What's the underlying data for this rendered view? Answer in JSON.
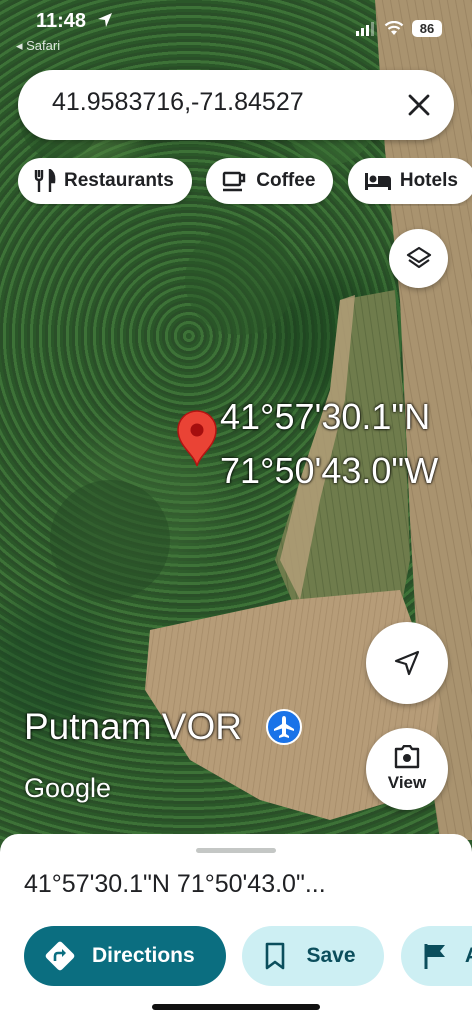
{
  "status_bar": {
    "time": "11:48",
    "back_app": "◂ Safari",
    "battery": "86",
    "icons": [
      "location-arrow-icon",
      "signal-icon",
      "wifi-icon",
      "battery-icon"
    ]
  },
  "search": {
    "value": "41.9583716,-71.84527"
  },
  "chips": [
    {
      "icon": "fork-knife-icon",
      "label": "Restaurants"
    },
    {
      "icon": "coffee-cup-icon",
      "label": "Coffee"
    },
    {
      "icon": "bed-icon",
      "label": "Hotels"
    }
  ],
  "map": {
    "pin_lat": "41°57'30.1\"N",
    "pin_lon": "71°50'43.0\"W",
    "poi_name": "Putnam VOR",
    "poi_icon": "airport-icon",
    "logo": "Google",
    "view_label": "View"
  },
  "sheet": {
    "title": "41°57'30.1\"N 71°50'43.0\"...",
    "actions": [
      {
        "icon": "directions-icon",
        "label": "Directions"
      },
      {
        "icon": "bookmark-icon",
        "label": "Save"
      },
      {
        "icon": "flag-icon",
        "label": "A"
      }
    ]
  },
  "colors": {
    "primary": "#0b6e80",
    "secondary_bg": "#cdeff3",
    "pin": "#ea4335",
    "poi_blue": "#1a73e8"
  }
}
